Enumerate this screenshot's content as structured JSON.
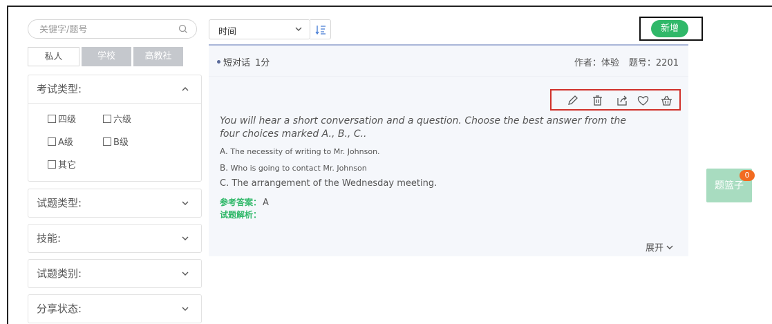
{
  "search": {
    "placeholder": "关键字/题号"
  },
  "tabs": [
    {
      "label": "私人",
      "active": true
    },
    {
      "label": "学校",
      "active": false
    },
    {
      "label": "高教社",
      "active": false
    }
  ],
  "filters": {
    "exam_type": {
      "label": "考试类型:",
      "expanded": true,
      "options": [
        "四级",
        "六级",
        "A级",
        "B级",
        "其它"
      ]
    },
    "question_type": {
      "label": "试题类型:"
    },
    "skill": {
      "label": "技能:"
    },
    "category": {
      "label": "试题类别:"
    },
    "share_status": {
      "label": "分享状态:"
    }
  },
  "sort": {
    "selected": "时间"
  },
  "toolbar": {
    "add_label": "新增"
  },
  "question": {
    "type": "短对话",
    "score": "1分",
    "author": "作者：体验",
    "number": "题号：2201",
    "text": "You will hear a short conversation and a question. Choose the best answer from the four choices marked A., B., C..",
    "options": [
      {
        "key": "A.",
        "text": "The necessity of writing to Mr. Johnson."
      },
      {
        "key": "B.",
        "text": "Who is going to contact Mr. Johnson"
      },
      {
        "key": "C.",
        "text": "The arrangement of the Wednesday meeting."
      }
    ],
    "answer_label": "参考答案：",
    "answer_value": "A",
    "analysis_label": "试题解析：",
    "expand_label": "展开"
  },
  "basket": {
    "label": "题篮子",
    "count": "0"
  },
  "colors": {
    "accent_green": "#30b869",
    "highlight_red": "#d0302a",
    "badge_orange": "#f26b21"
  }
}
